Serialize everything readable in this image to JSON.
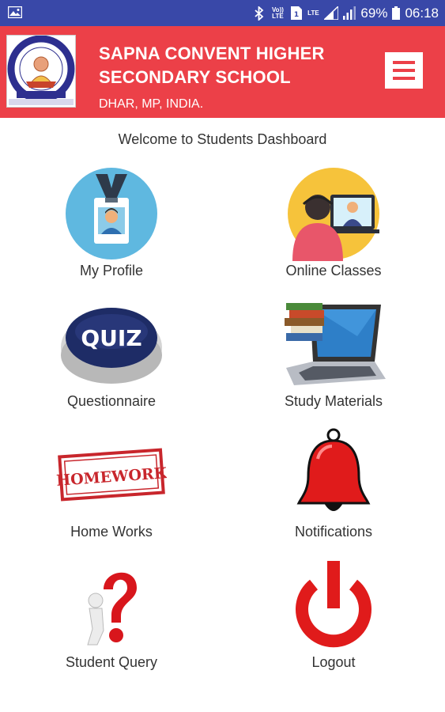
{
  "status_bar": {
    "volte_label": "Vo)) LTE",
    "lte_label": "LTE",
    "battery_percent": "69%",
    "time": "06:18"
  },
  "header": {
    "title_line1": "SAPNA CONVENT HIGHER",
    "title_line2": "SECONDARY SCHOOL",
    "location": "DHAR, MP, INDIA.",
    "accent_color": "#ec4048"
  },
  "dashboard": {
    "welcome": "Welcome to Students Dashboard",
    "tiles": [
      {
        "label": "My Profile",
        "icon": "profile-badge-icon"
      },
      {
        "label": "Online Classes",
        "icon": "online-classes-icon"
      },
      {
        "label": "Questionnaire",
        "icon": "quiz-button-icon"
      },
      {
        "label": "Study Materials",
        "icon": "laptop-books-icon"
      },
      {
        "label": "Home Works",
        "icon": "homework-stamp-icon"
      },
      {
        "label": "Notifications",
        "icon": "bell-icon"
      },
      {
        "label": "Student Query",
        "icon": "question-mark-figure-icon"
      },
      {
        "label": "Logout",
        "icon": "power-icon"
      }
    ],
    "quiz_text": "QUIZ",
    "homework_text": "HOMEWORK"
  }
}
